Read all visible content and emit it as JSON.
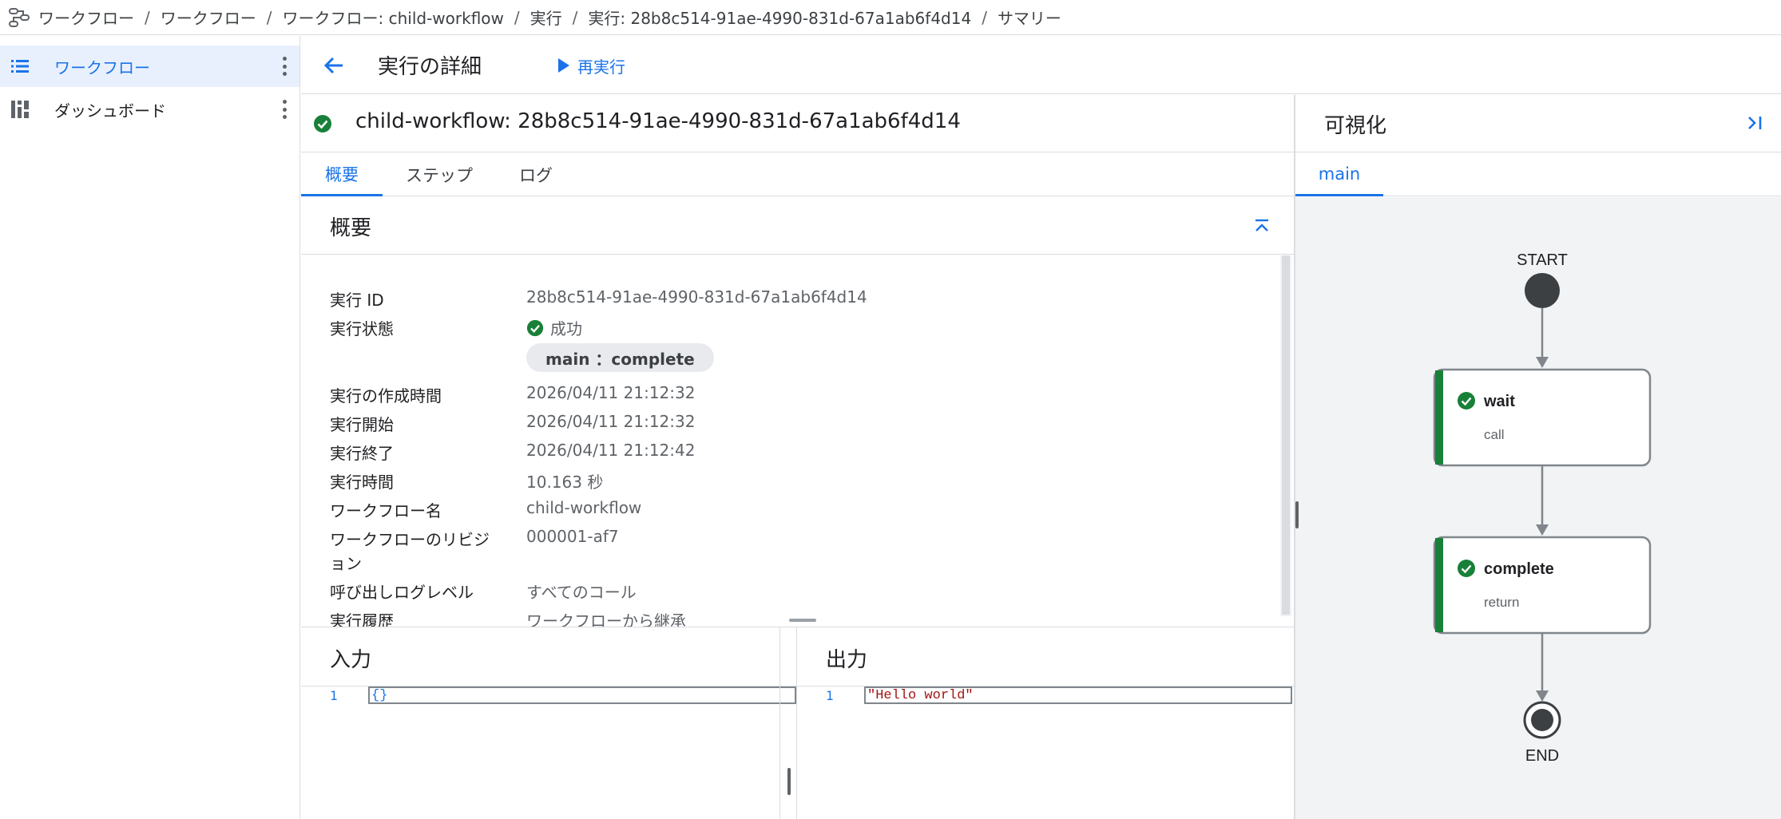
{
  "breadcrumb": [
    "ワークフロー",
    "ワークフロー",
    "ワークフロー: child-workflow",
    "実行",
    "実行: 28b8c514-91ae-4990-831d-67a1ab6f4d14",
    "サマリー"
  ],
  "breadcrumb_sep": "/",
  "sidebar": {
    "items": [
      {
        "label": "ワークフロー",
        "icon": "list-icon",
        "active": true
      },
      {
        "label": "ダッシュボード",
        "icon": "dashboard-icon",
        "active": false
      }
    ]
  },
  "toolbar": {
    "title": "実行の詳細",
    "rerun_label": "再実行"
  },
  "execution": {
    "title": "child-workflow: 28b8c514-91ae-4990-831d-67a1ab6f4d14"
  },
  "tabs": [
    "概要",
    "ステップ",
    "ログ"
  ],
  "summary": {
    "heading": "概要",
    "rows": [
      {
        "label": "実行 ID",
        "value": "28b8c514-91ae-4990-831d-67a1ab6f4d14"
      },
      {
        "label": "実行状態",
        "value": "成功"
      },
      {
        "label": "実行の作成時間",
        "value": "2026/04/11 21:12:32"
      },
      {
        "label": "実行開始",
        "value": "2026/04/11 21:12:32"
      },
      {
        "label": "実行終了",
        "value": "2026/04/11 21:12:42"
      },
      {
        "label": "実行時間",
        "value": "10.163 秒"
      },
      {
        "label": "ワークフロー名",
        "value": "child-workflow"
      },
      {
        "label": "ワークフローのリビジ",
        "label2": "ョン",
        "value": "000001-af7"
      },
      {
        "label": "呼び出しログレベル",
        "value": "すべてのコール"
      },
      {
        "label": "実行履歴",
        "value": "ワークフローから継承"
      }
    ],
    "chip": "main ：complete"
  },
  "input": {
    "heading": "入力",
    "line_no": "1",
    "code": "{}"
  },
  "output": {
    "heading": "出力",
    "line_no": "1",
    "code": "\"Hello world\""
  },
  "visualization": {
    "heading": "可視化",
    "tab": "main",
    "start_label": "START",
    "end_label": "END",
    "steps": [
      {
        "name": "wait",
        "type": "call"
      },
      {
        "name": "complete",
        "type": "return"
      }
    ]
  },
  "colors": {
    "accent": "#1a73e8",
    "success": "#188038",
    "node_border": "#80868b"
  }
}
